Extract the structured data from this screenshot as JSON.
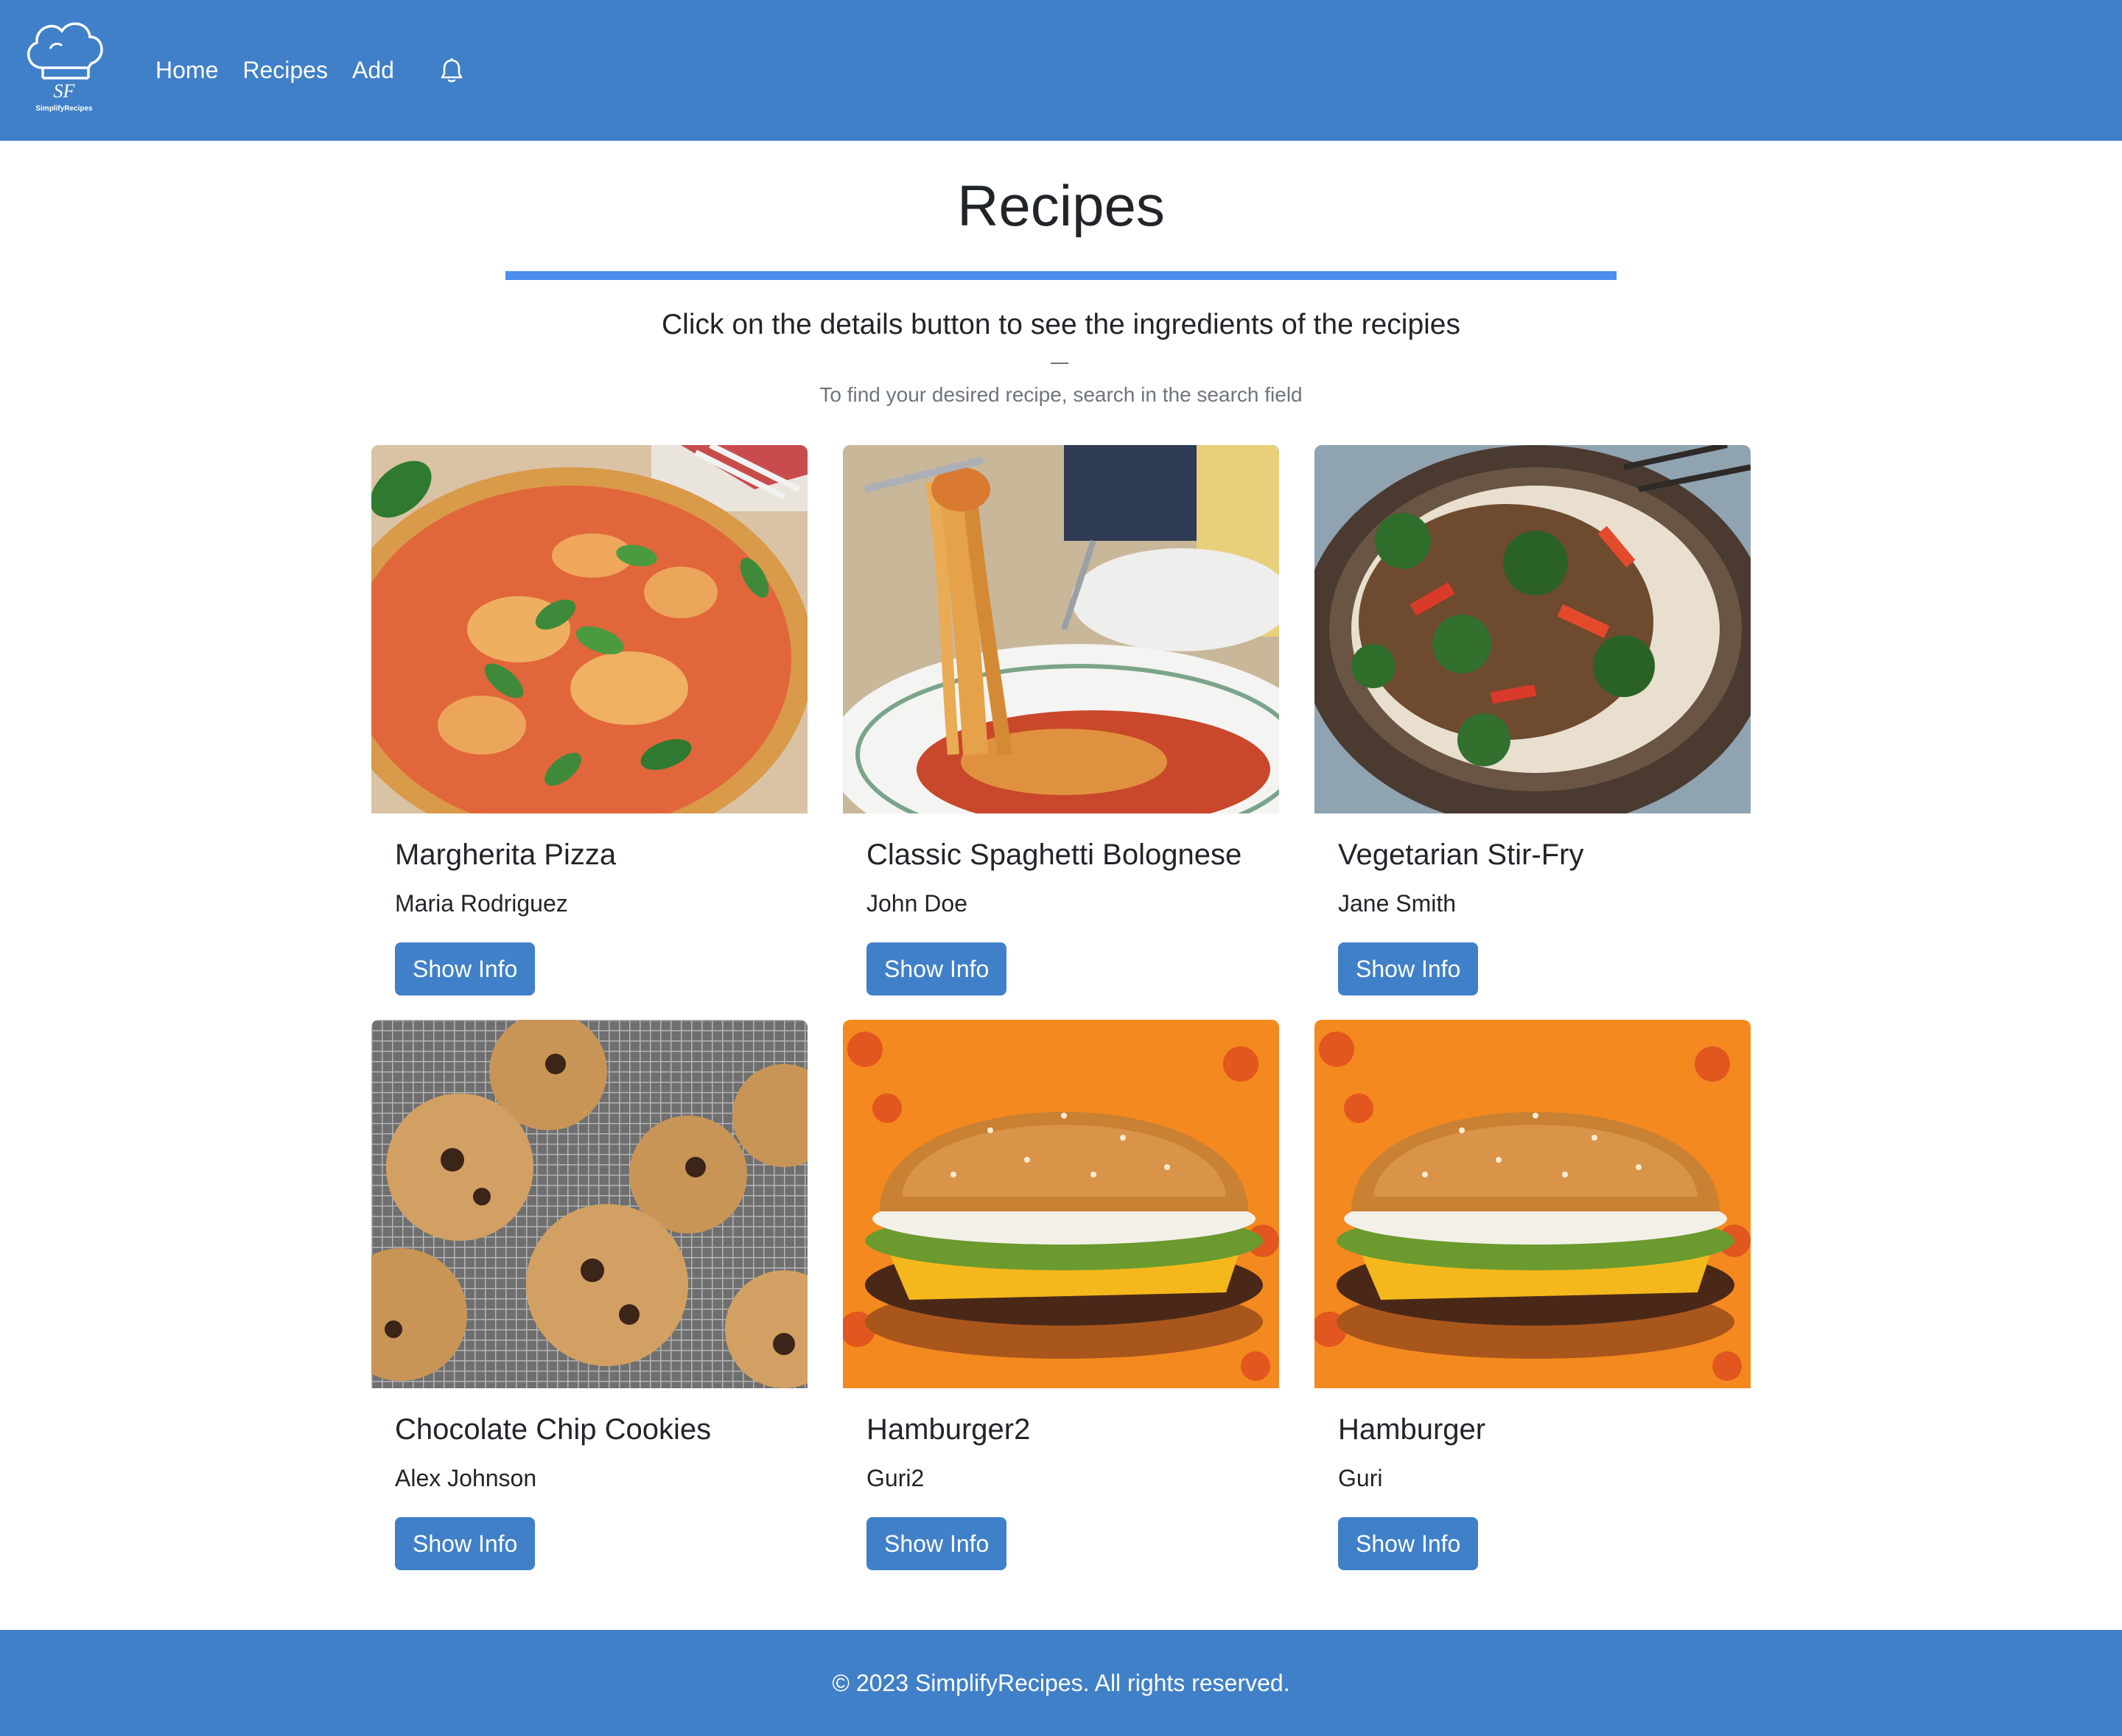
{
  "nav": {
    "brand_initials": "SF",
    "brand_name": "SimplifyRecipes",
    "links": [
      "Home",
      "Recipes",
      "Add"
    ],
    "bell_icon": "bell-icon"
  },
  "header": {
    "title": "Recipes",
    "subtitle": "Click on the details button to see the ingredients of the recipies",
    "hint": "To find your desired recipe, search in the search field"
  },
  "recipes": [
    {
      "title": "Margherita Pizza",
      "author": "Maria Rodriguez",
      "button": "Show Info",
      "image": "pizza"
    },
    {
      "title": "Classic Spaghetti Bolognese",
      "author": "John Doe",
      "button": "Show Info",
      "image": "spaghetti"
    },
    {
      "title": "Vegetarian Stir-Fry",
      "author": "Jane Smith",
      "button": "Show Info",
      "image": "stir-fry"
    },
    {
      "title": "Chocolate Chip Cookies",
      "author": "Alex Johnson",
      "button": "Show Info",
      "image": "cookies"
    },
    {
      "title": "Hamburger2",
      "author": "Guri2",
      "button": "Show Info",
      "image": "hamburger"
    },
    {
      "title": "Hamburger",
      "author": "Guri",
      "button": "Show Info",
      "image": "hamburger"
    }
  ],
  "footer": {
    "text": "© 2023 SimplifyRecipes. All rights reserved."
  },
  "colors": {
    "navbar": "#4080c8",
    "accent_rule": "#4b8ef0",
    "button": "#4080c8"
  }
}
